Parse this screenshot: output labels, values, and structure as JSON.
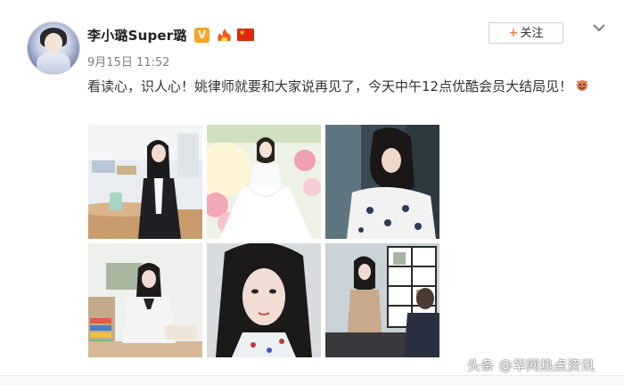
{
  "post": {
    "user_name": "李小璐Super璐",
    "verified_mark": "V",
    "timestamp": "9月15日 11:52",
    "follow_label": "关注",
    "follow_plus": "+",
    "text": "看读心，识人心！姚律师就要和大家说再见了，今天中午12点优酷会员大结局见！",
    "photos": [
      {
        "scene": "office-desk-black-blazer"
      },
      {
        "scene": "wedding-dress-flowers"
      },
      {
        "scene": "floral-blouse-dark-room"
      },
      {
        "scene": "office-books-bow-blouse"
      },
      {
        "scene": "portrait-closeup"
      },
      {
        "scene": "office-bookshelf-meeting"
      }
    ]
  },
  "watermark": "头条 @华网热点资讯",
  "colors": {
    "accent_orange": "#fa7d3c",
    "vip_gold": "#f5a623",
    "flag_red": "#de2910"
  }
}
